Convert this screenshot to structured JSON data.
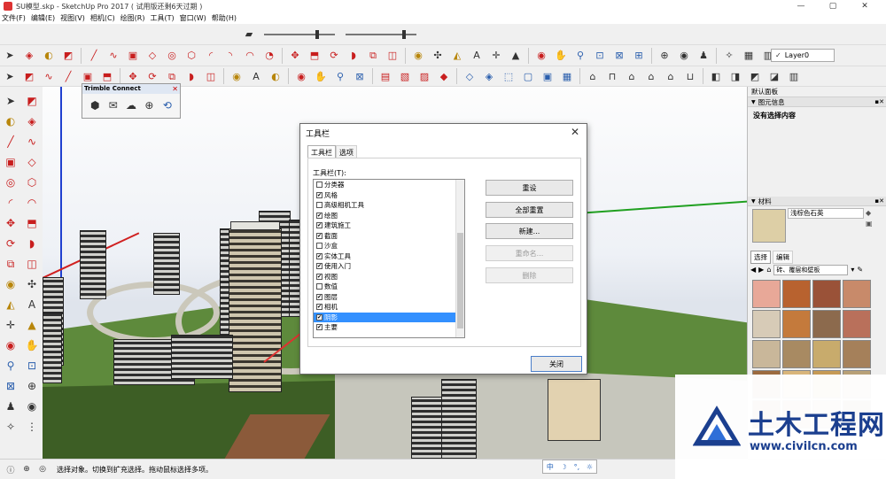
{
  "app": {
    "title": "SU模型.skp - SketchUp Pro 2017  ( 试用版还剩6天过期 )",
    "window_controls": [
      "—",
      "▢",
      "✕"
    ]
  },
  "menu": [
    "文件(F)",
    "编辑(E)",
    "视图(V)",
    "相机(C)",
    "绘图(R)",
    "工具(T)",
    "窗口(W)",
    "帮助(H)"
  ],
  "toolbar": {
    "layer_value": "Layer0",
    "layer_check": "✓"
  },
  "trimble": {
    "title": "Trimble Connect",
    "close": "✕"
  },
  "dialog": {
    "title": "工具栏",
    "close": "✕",
    "tabs": [
      "工具栏",
      "选项"
    ],
    "list_label": "工具栏(T):",
    "items": [
      {
        "label": "分类器",
        "checked": false
      },
      {
        "label": "风格",
        "checked": true
      },
      {
        "label": "高级相机工具",
        "checked": false
      },
      {
        "label": "绘图",
        "checked": true
      },
      {
        "label": "建筑施工",
        "checked": true
      },
      {
        "label": "截面",
        "checked": true
      },
      {
        "label": "沙盒",
        "checked": false
      },
      {
        "label": "实体工具",
        "checked": true
      },
      {
        "label": "使用入门",
        "checked": true
      },
      {
        "label": "视图",
        "checked": true
      },
      {
        "label": "数值",
        "checked": false
      },
      {
        "label": "图层",
        "checked": true
      },
      {
        "label": "相机",
        "checked": true
      },
      {
        "label": "阴影",
        "checked": true,
        "selected": true
      },
      {
        "label": "主要",
        "checked": true
      }
    ],
    "buttons": {
      "reset": "重设",
      "reset_all": "全部重置",
      "new": "新建...",
      "rename": "重命名...",
      "delete": "删除",
      "close": "关闭"
    }
  },
  "right_panel": {
    "title": "默认面板",
    "entity_section": "图元信息",
    "entity_text": "没有选择内容",
    "materials_section": "材料",
    "material_name": "浅棕色石英",
    "tabs": [
      "选择",
      "编辑"
    ],
    "category": "砖、覆层和壁板",
    "swatch_colors": [
      "#e8a898",
      "#b8622f",
      "#9a5238",
      "#c88a6a",
      "#d7cbb7",
      "#c47a3c",
      "#8c6a4d",
      "#b9705b",
      "#c9b79a",
      "#a88a62",
      "#c8ab6c",
      "#a5805a",
      "#9c6a3f",
      "#d9b57a",
      "#c69a55",
      "#b8a077",
      "#9a6a47",
      "#b38a60",
      "#c2a27a",
      "#8e6e52"
    ]
  },
  "status": {
    "text": "选择对象。切换到扩充选择。拖动鼠标选择多项。",
    "ime": [
      "中",
      "☽",
      "°,",
      "☼"
    ]
  },
  "watermark": {
    "title": "土木工程网",
    "url": "www.civilcn.com"
  }
}
